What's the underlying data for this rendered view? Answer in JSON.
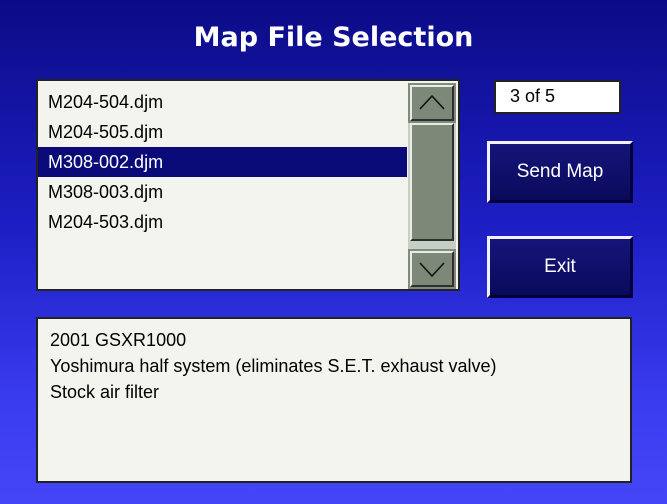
{
  "window": {
    "title": "Map File Selection"
  },
  "file_list": {
    "items": [
      {
        "label": "M204-504.djm",
        "selected": false
      },
      {
        "label": "M204-505.djm",
        "selected": false
      },
      {
        "label": "M308-002.djm",
        "selected": true
      },
      {
        "label": "M308-003.djm",
        "selected": false
      },
      {
        "label": "M204-503.djm",
        "selected": false
      }
    ],
    "scroll_up_icon": "chevron-up-icon",
    "scroll_down_icon": "chevron-down-icon"
  },
  "page_indicator": "3 of 5",
  "buttons": {
    "send_map": "Send Map",
    "exit": "Exit"
  },
  "description": {
    "lines": [
      "2001 GSXR1000",
      "Yoshimura half system (eliminates S.E.T. exhaust valve)",
      "Stock air filter"
    ]
  },
  "colors": {
    "background_top": "#0b0b86",
    "background_bottom": "#4446f6",
    "selection": "#0a0a78",
    "button": "#15157a"
  }
}
